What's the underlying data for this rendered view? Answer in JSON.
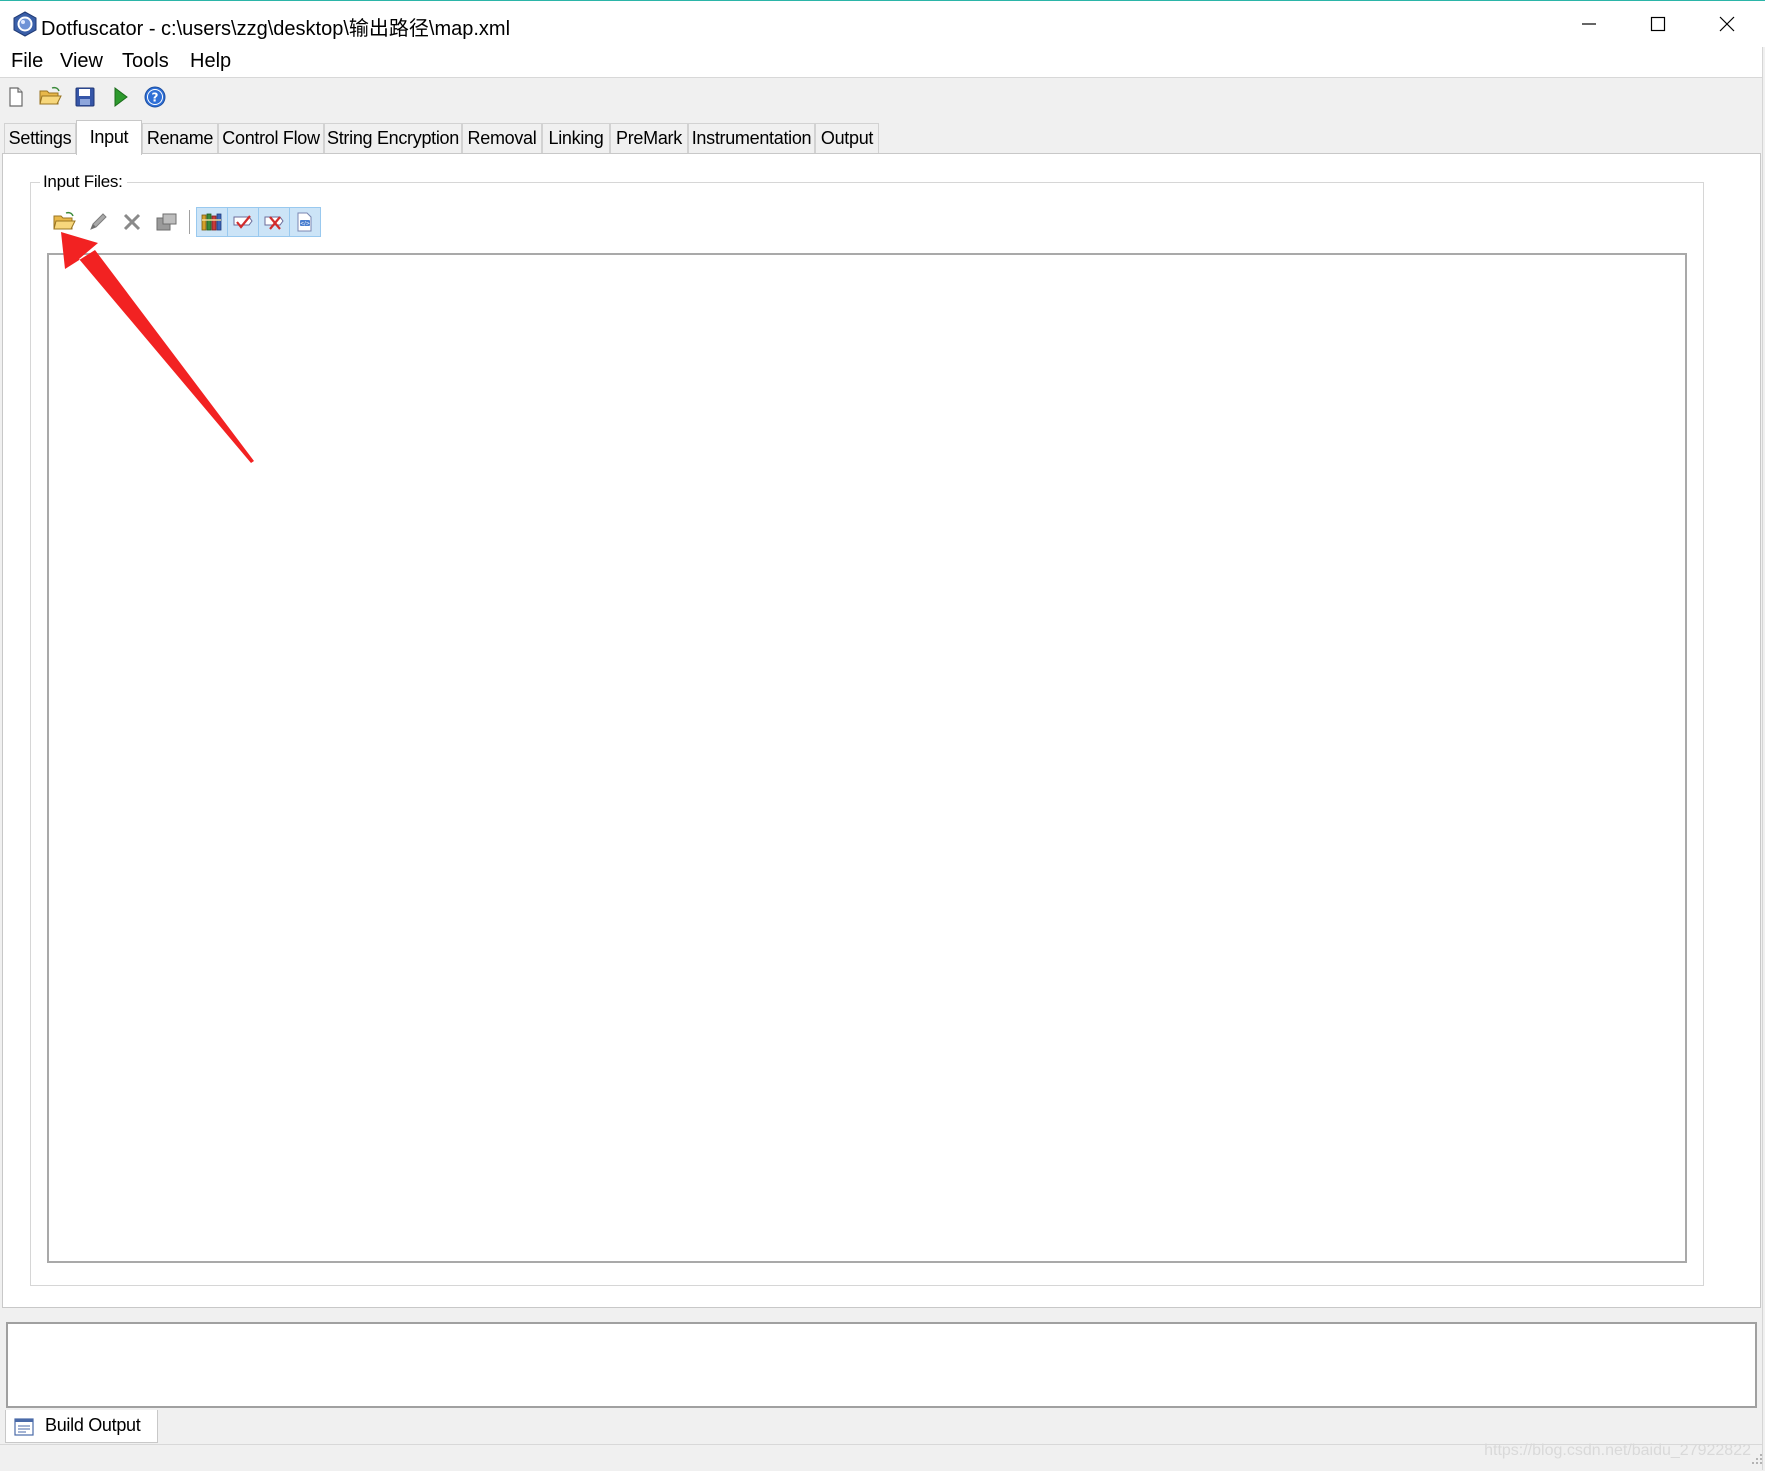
{
  "window": {
    "title": "Dotfuscator - c:\\users\\zzg\\desktop\\输出路径\\map.xml",
    "accent_color": "#2bb5a8",
    "controls": [
      "minimize-icon",
      "maximize-icon",
      "close-icon"
    ]
  },
  "menu": {
    "items": [
      "File",
      "View",
      "Tools",
      "Help"
    ]
  },
  "toolbar": {
    "icons": [
      "new-file-icon",
      "open-folder-icon",
      "save-icon",
      "run-icon",
      "help-icon"
    ]
  },
  "tabs": {
    "active": "Input",
    "items": [
      "Settings",
      "Input",
      "Rename",
      "Control Flow",
      "String Encryption",
      "Removal",
      "Linking",
      "PreMark",
      "Instrumentation",
      "Output"
    ]
  },
  "input_panel": {
    "group_label": "Input Files:",
    "toolbar_icons": [
      "add-input-folder-icon",
      "edit-icon",
      "delete-icon",
      "properties-icon",
      "library-icon",
      "check-icon",
      "remove-check-icon",
      "xml-config-icon"
    ],
    "annotation_color": "#f22222"
  },
  "build": {
    "tab_label": "Build Output"
  },
  "watermark": "https://blog.csdn.net/baidu_27922822"
}
